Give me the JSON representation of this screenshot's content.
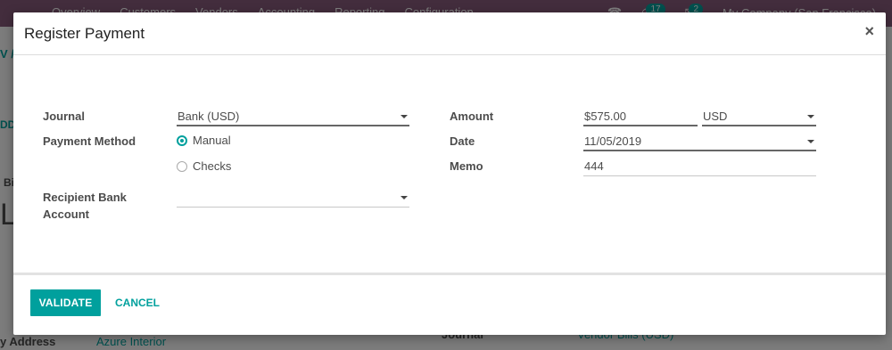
{
  "background": {
    "nav_items": [
      "Overview",
      "Customers",
      "Vendors",
      "Accounting",
      "Reporting",
      "Configuration"
    ],
    "activity_count": "17",
    "messages_count": "2",
    "company": "My Company (San Francisco)",
    "breadcrumb_fragment": "V /",
    "button_fragment": "DD",
    "label_fragment": "Bi",
    "title_fragment": "LL",
    "field1_label": "y Address",
    "field1_value": "Azure Interior",
    "field2_label": "Journal",
    "field2_value": "Vendor Bills (USD)"
  },
  "modal": {
    "title": "Register Payment",
    "close_glyph": "×",
    "journal": {
      "label": "Journal",
      "value": "Bank (USD)"
    },
    "payment_method": {
      "label": "Payment Method",
      "options": [
        {
          "label": "Manual",
          "checked": true
        },
        {
          "label": "Checks",
          "checked": false
        }
      ]
    },
    "recipient_bank_account": {
      "label_line1": "Recipient Bank",
      "label_line2": "Account",
      "value": ""
    },
    "amount": {
      "label": "Amount",
      "value": "$575.00",
      "currency": "USD"
    },
    "date": {
      "label": "Date",
      "value": "11/05/2019"
    },
    "memo": {
      "label": "Memo",
      "value": "444"
    },
    "footer": {
      "validate_label": "VALIDATE",
      "cancel_label": "CANCEL"
    }
  },
  "colors": {
    "accent": "#00a09d",
    "navbar": "#875a7b"
  }
}
